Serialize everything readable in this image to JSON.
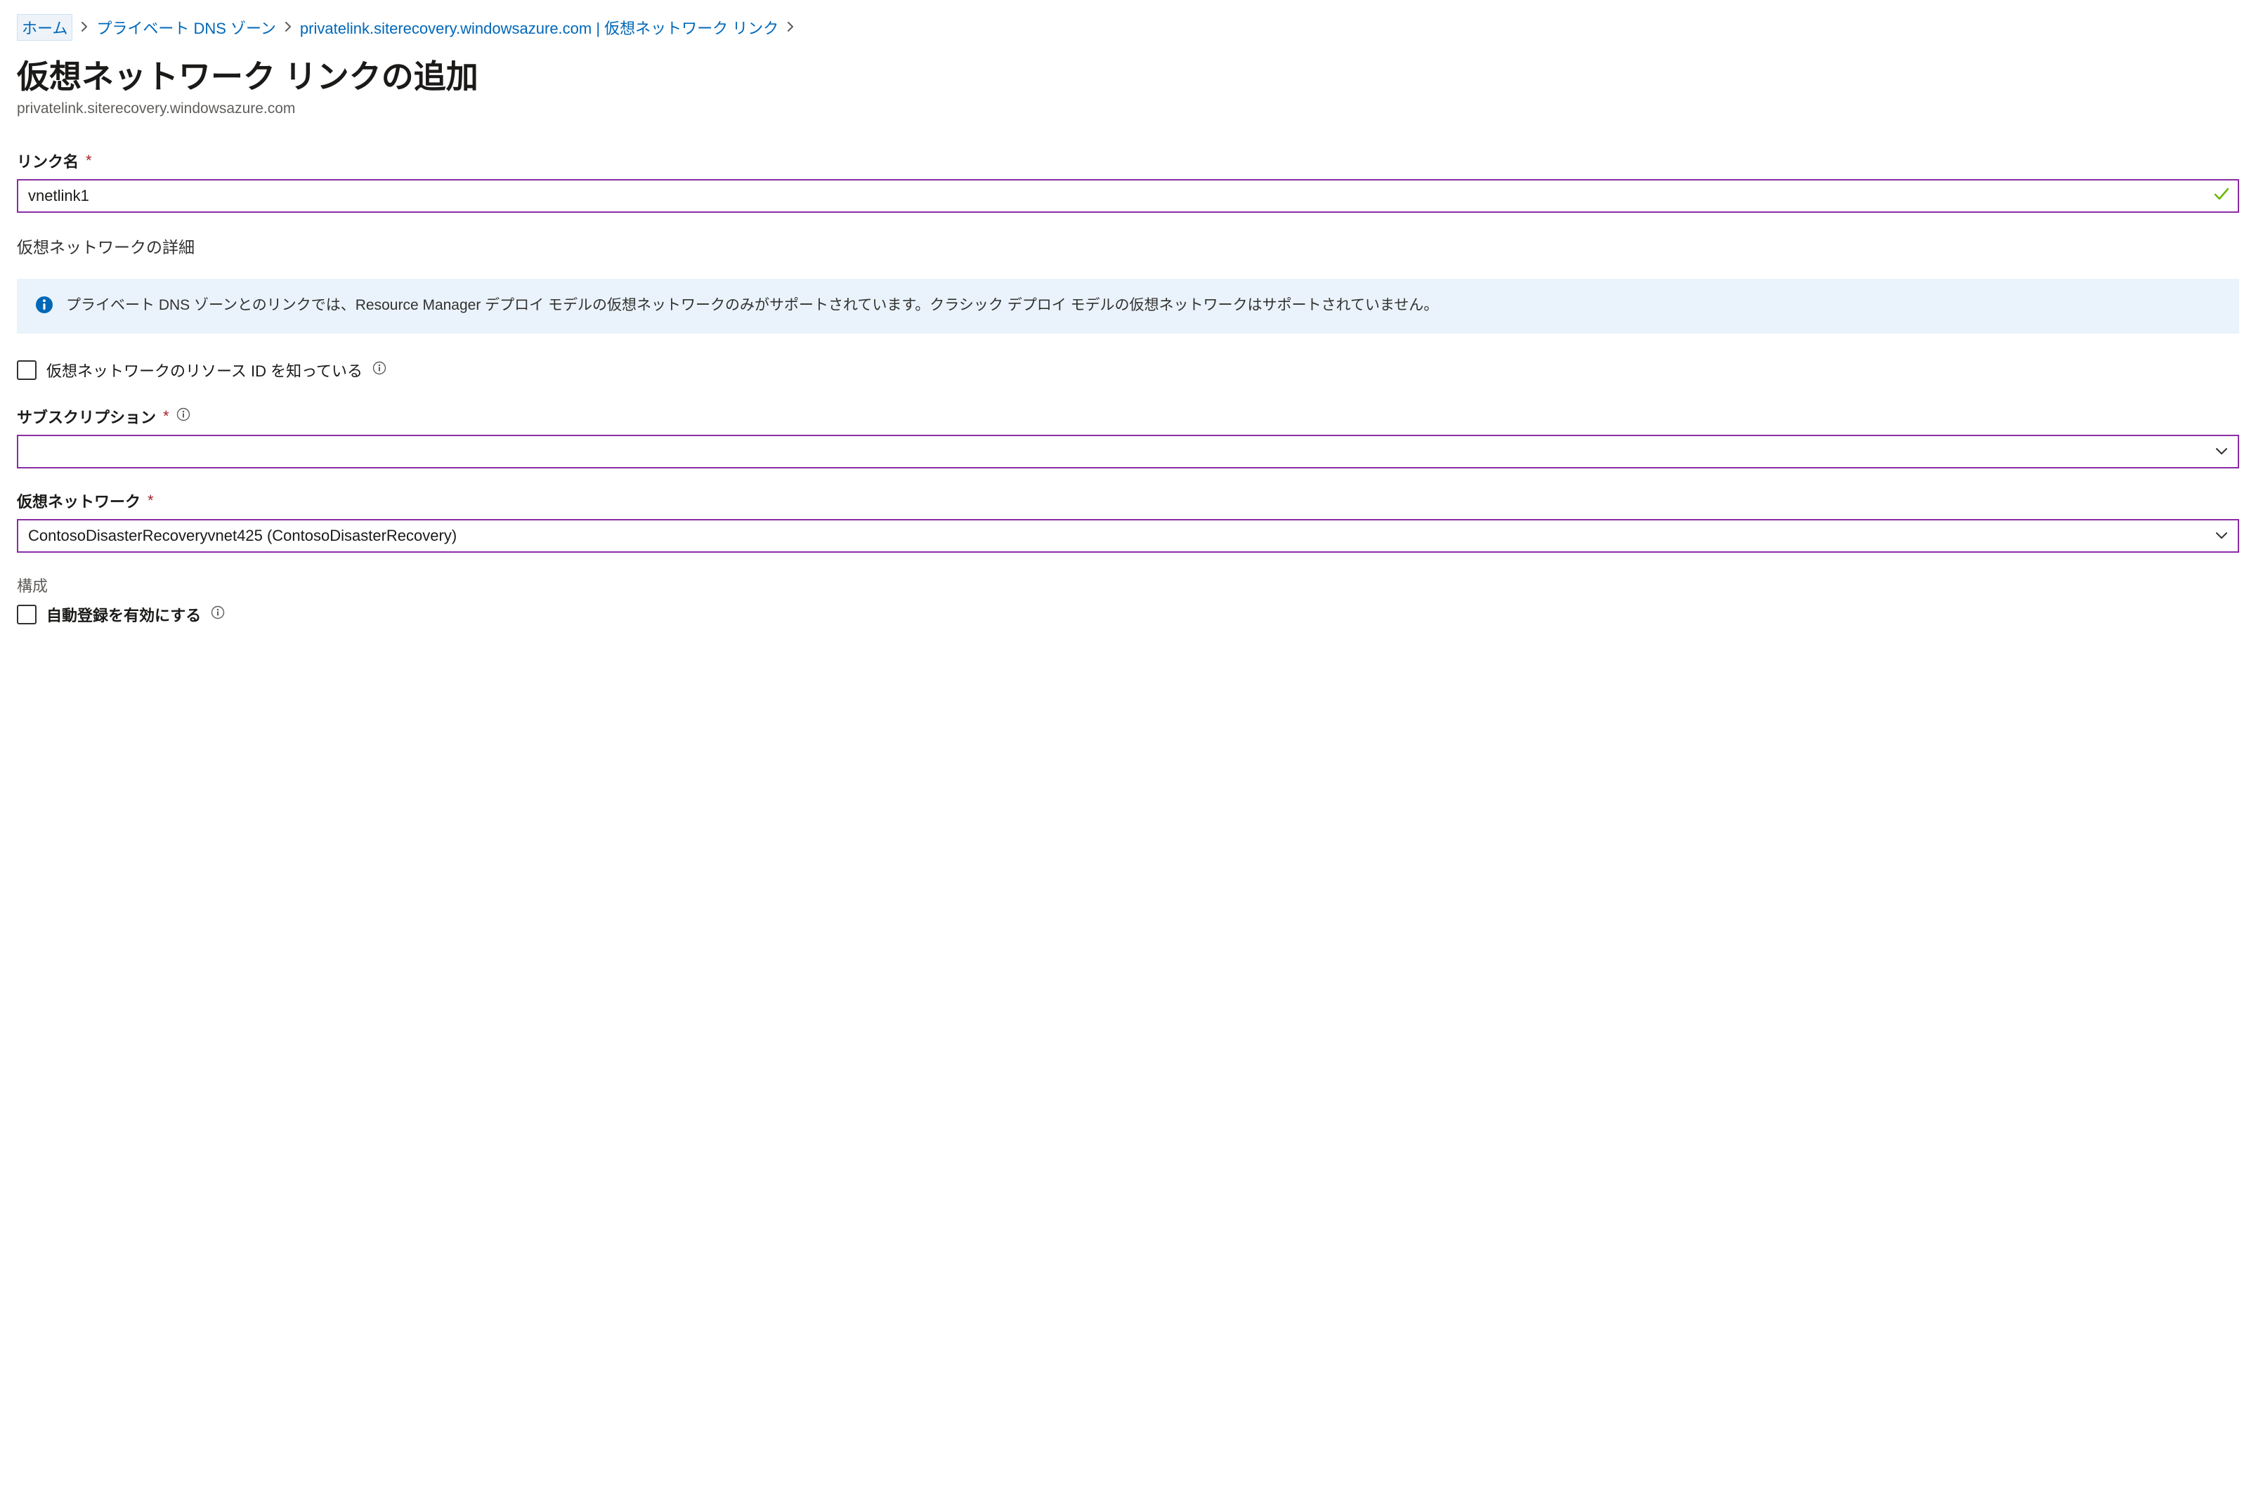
{
  "breadcrumb": {
    "home": "ホーム",
    "dns_zones": "プライベート DNS ゾーン",
    "zone_detail": "privatelink.siterecovery.windowsazure.com | 仮想ネットワーク リンク"
  },
  "header": {
    "title": "仮想ネットワーク リンクの追加",
    "subtitle": "privatelink.siterecovery.windowsazure.com"
  },
  "fields": {
    "link_name": {
      "label": "リンク名",
      "value": "vnetlink1"
    },
    "vnet_details_heading": "仮想ネットワークの詳細",
    "info_message": "プライベート DNS ゾーンとのリンクでは、Resource Manager デプロイ モデルの仮想ネットワークのみがサポートされています。クラシック デプロイ モデルの仮想ネットワークはサポートされていません。",
    "know_resource_id": {
      "label": "仮想ネットワークのリソース ID を知っている"
    },
    "subscription": {
      "label": "サブスクリプション",
      "value": ""
    },
    "virtual_network": {
      "label": "仮想ネットワーク",
      "value": "ContosoDisasterRecoveryvnet425 (ContosoDisasterRecovery)"
    },
    "configuration_heading": "構成",
    "auto_registration": {
      "label": "自動登録を有効にする"
    }
  },
  "colors": {
    "accent_border": "#8a2da5",
    "link": "#0067b8",
    "info_bg": "#eaf3fb",
    "info_dot": "#0067b8",
    "required": "#a4262c",
    "valid": "#6bb700"
  }
}
